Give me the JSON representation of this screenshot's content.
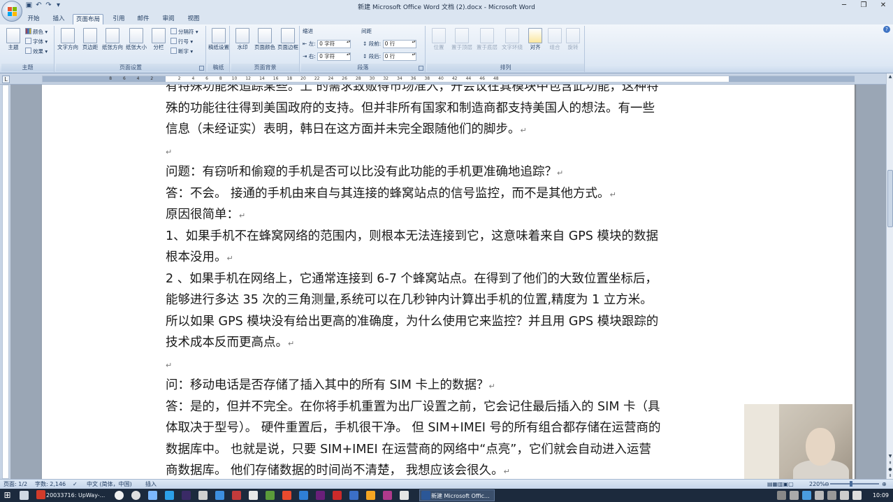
{
  "window": {
    "title": "新建 Microsoft Office Word 文档 (2).docx - Microsoft Word",
    "controls": {
      "minimize": "─",
      "restore": "❐",
      "close": "✕"
    }
  },
  "quick_access": {
    "save_icon": "save-icon",
    "undo_icon": "undo-icon",
    "redo_icon": "redo-icon",
    "customize": "▾"
  },
  "ribbon": {
    "tabs": [
      {
        "label": "开始",
        "active": false
      },
      {
        "label": "插入",
        "active": false
      },
      {
        "label": "页面布局",
        "active": true
      },
      {
        "label": "引用",
        "active": false
      },
      {
        "label": "邮件",
        "active": false
      },
      {
        "label": "审阅",
        "active": false
      },
      {
        "label": "视图",
        "active": false
      }
    ],
    "groups": {
      "theme": {
        "label": "主题",
        "main_button": "主题",
        "colors": "颜色 ▾",
        "fonts": "字体 ▾",
        "effects": "效果 ▾"
      },
      "page_setup": {
        "label": "页面设置",
        "text_direction": "文字方向",
        "margins": "页边距",
        "orientation": "纸张方向",
        "size": "纸张大小",
        "columns": "分栏",
        "breaks": "分隔符 ▾",
        "line_numbers": "行号 ▾",
        "hyphenation": "断字 ▾"
      },
      "draft": {
        "label": "稿纸",
        "draft_settings": "稿纸设置"
      },
      "page_background": {
        "label": "页面背景",
        "watermark": "水印",
        "page_color": "页面颜色",
        "page_borders": "页面边框"
      },
      "paragraph": {
        "label": "段落",
        "indent_title": "缩进",
        "spacing_title": "间距",
        "indent_left_label": "左:",
        "indent_left_value": "0 字符",
        "indent_right_label": "右:",
        "indent_right_value": "0 字符",
        "spacing_before_label": "段前:",
        "spacing_before_value": "0 行",
        "spacing_after_label": "段后:",
        "spacing_after_value": "0 行"
      },
      "arrange": {
        "label": "排列",
        "position": "位置",
        "bring_front": "置于顶层",
        "send_back": "置于底层",
        "text_wrap": "文字环绕",
        "align": "对齐",
        "group": "组合",
        "rotate": "旋转"
      }
    }
  },
  "ruler": {
    "tab_selector": "L",
    "numbers": [
      "8",
      "6",
      "4",
      "2",
      "2",
      "4",
      "6",
      "8",
      "10",
      "12",
      "14",
      "16",
      "18",
      "20",
      "22",
      "24",
      "26",
      "28",
      "30",
      "32",
      "34",
      "36",
      "38",
      "40",
      "42",
      "44",
      "46",
      "48"
    ]
  },
  "document": {
    "lines": [
      {
        "text": "有特殊功能來追踪某些。上 的需求致贩得市场准入，开会议在其模块中包含此功能，这种特",
        "mark": ""
      },
      {
        "text": "殊的功能往往得到美国政府的支持。但并非所有国家和制造商都支持美国人的想法。有一些",
        "mark": ""
      },
      {
        "text": "信息（未经证实）表明，韩日在这方面并未完全跟随他们的脚步。",
        "mark": "↵"
      },
      {
        "text": "",
        "mark": "↵"
      },
      {
        "text": "问题：有窃听和偷窥的手机是否可以比没有此功能的手机更准确地追踪？",
        "mark": "↵"
      },
      {
        "text": "答：不会。 接通的手机由来自与其连接的蜂窝站点的信号监控，而不是其他方式。",
        "mark": "↵"
      },
      {
        "text": "原因很简单：",
        "mark": "↵"
      },
      {
        "text": "1、如果手机不在蜂窝网络的范围内，则根本无法连接到它，这意味着来自 GPS 模块的数据",
        "mark": ""
      },
      {
        "text": "根本没用。",
        "mark": "↵"
      },
      {
        "text": "2 、如果手机在网络上，它通常连接到 6-7 个蜂窝站点。在得到了他们的大致位置坐标后，",
        "mark": ""
      },
      {
        "text": "能够进行多达 35 次的三角测量,系统可以在几秒钟内计算出手机的位置,精度为 1 立方米。",
        "mark": ""
      },
      {
        "text": "所以如果 GPS 模块没有给出更高的准确度，为什么使用它来监控？并且用 GPS 模块跟踪的",
        "mark": ""
      },
      {
        "text": "技术成本反而更高点。",
        "mark": "↵"
      },
      {
        "text": "",
        "mark": "↵"
      },
      {
        "text": "问：移动电话是否存储了插入其中的所有 SIM 卡上的数据？",
        "mark": "↵"
      },
      {
        "text": "答：是的，但并不完全。在你将手机重置为出厂设置之前，它会记住最后插入的 SIM 卡（具",
        "mark": ""
      },
      {
        "text": "体取决于型号）。 硬件重置后，手机很干净。 但 SIM+IMEI 号的所有组合都存储在运营商的",
        "mark": ""
      },
      {
        "text": "数据库中。 也就是说，只要 SIM+IMEI 在运营商的网络中“点亮”，它们就会自动进入运营",
        "mark": ""
      },
      {
        "text": "商数据库。 他们存储数据的时间尚不清楚， 我想应该会很久。",
        "mark": "↵"
      }
    ]
  },
  "statusbar": {
    "page": "页面: 1/2",
    "words": "字数: 2,146",
    "language": "中文 (简体，中国)",
    "mode": "插入",
    "zoom": "220%",
    "zoom_minus": "⊖",
    "zoom_plus": "⊕"
  },
  "taskbar": {
    "items": [
      {
        "label": "20033716: UpWay-...",
        "active": false
      },
      {
        "label": "新建 Microsoft Offic...",
        "active": true
      }
    ],
    "clock": "10:09"
  }
}
